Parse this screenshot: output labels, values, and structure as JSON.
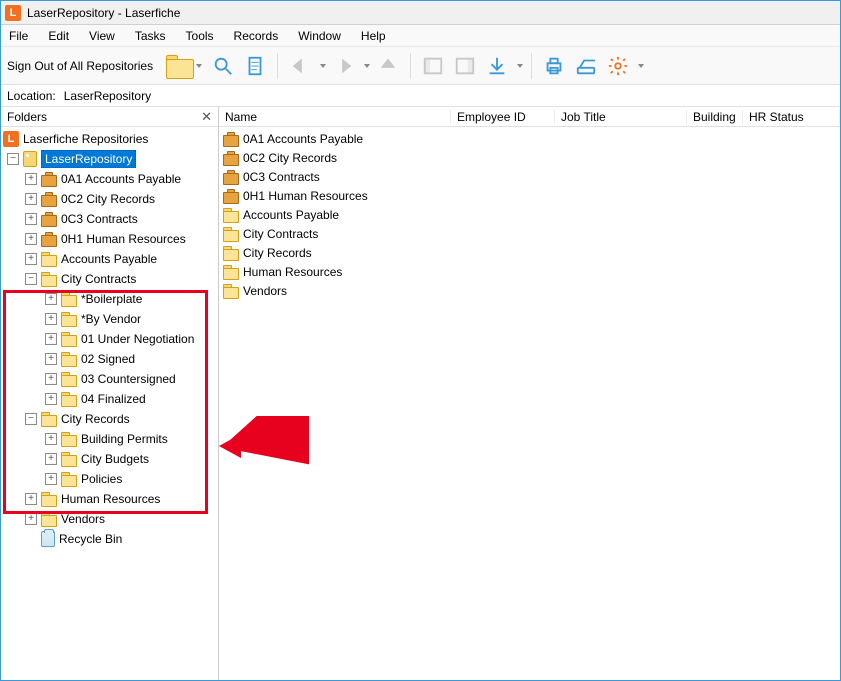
{
  "window": {
    "title": "LaserRepository - Laserfiche"
  },
  "menu": [
    "File",
    "Edit",
    "View",
    "Tasks",
    "Tools",
    "Records",
    "Window",
    "Help"
  ],
  "toolbar": {
    "signout": "Sign Out of All Repositories"
  },
  "location": {
    "label": "Location:",
    "value": "LaserRepository"
  },
  "folders": {
    "header": "Folders",
    "root": {
      "label": "Laserfiche Repositories"
    },
    "repo": {
      "label": "LaserRepository",
      "selected": true
    },
    "level2": [
      {
        "label": "0A1 Accounts Payable",
        "icon": "briefcase",
        "expander": "+"
      },
      {
        "label": "0C2 City Records",
        "icon": "briefcase",
        "expander": "+"
      },
      {
        "label": "0C3 Contracts",
        "icon": "briefcase",
        "expander": "+"
      },
      {
        "label": "0H1 Human Resources",
        "icon": "briefcase",
        "expander": "+"
      },
      {
        "label": "Accounts Payable",
        "icon": "folder",
        "expander": "+"
      },
      {
        "label": "City Contracts",
        "icon": "folder",
        "expander": "-",
        "children": [
          {
            "label": "*Boilerplate",
            "expander": "+"
          },
          {
            "label": "*By Vendor",
            "expander": "+"
          },
          {
            "label": "01 Under Negotiation",
            "expander": "+"
          },
          {
            "label": "02 Signed",
            "expander": "+"
          },
          {
            "label": "03 Countersigned",
            "expander": "+"
          },
          {
            "label": "04 Finalized",
            "expander": "+"
          }
        ]
      },
      {
        "label": "City Records",
        "icon": "folder",
        "expander": "-",
        "children": [
          {
            "label": "Building Permits",
            "expander": "+"
          },
          {
            "label": "City Budgets",
            "expander": "+"
          },
          {
            "label": "Policies",
            "expander": "+"
          }
        ]
      },
      {
        "label": "Human Resources",
        "icon": "folder",
        "expander": "+"
      },
      {
        "label": "Vendors",
        "icon": "folder",
        "expander": "+"
      }
    ],
    "recycle": {
      "label": "Recycle Bin"
    }
  },
  "columns": {
    "name": "Name",
    "employee_id": "Employee ID",
    "job_title": "Job Title",
    "building": "Building",
    "hr_status": "HR Status"
  },
  "list": [
    {
      "label": "0A1 Accounts Payable",
      "icon": "briefcase"
    },
    {
      "label": "0C2 City Records",
      "icon": "briefcase"
    },
    {
      "label": "0C3 Contracts",
      "icon": "briefcase"
    },
    {
      "label": "0H1 Human Resources",
      "icon": "briefcase"
    },
    {
      "label": "Accounts Payable",
      "icon": "folder"
    },
    {
      "label": "City Contracts",
      "icon": "folder"
    },
    {
      "label": "City Records",
      "icon": "folder"
    },
    {
      "label": "Human Resources",
      "icon": "folder"
    },
    {
      "label": "Vendors",
      "icon": "folder"
    }
  ],
  "annotation": {
    "highlight_color": "#e8001f"
  }
}
